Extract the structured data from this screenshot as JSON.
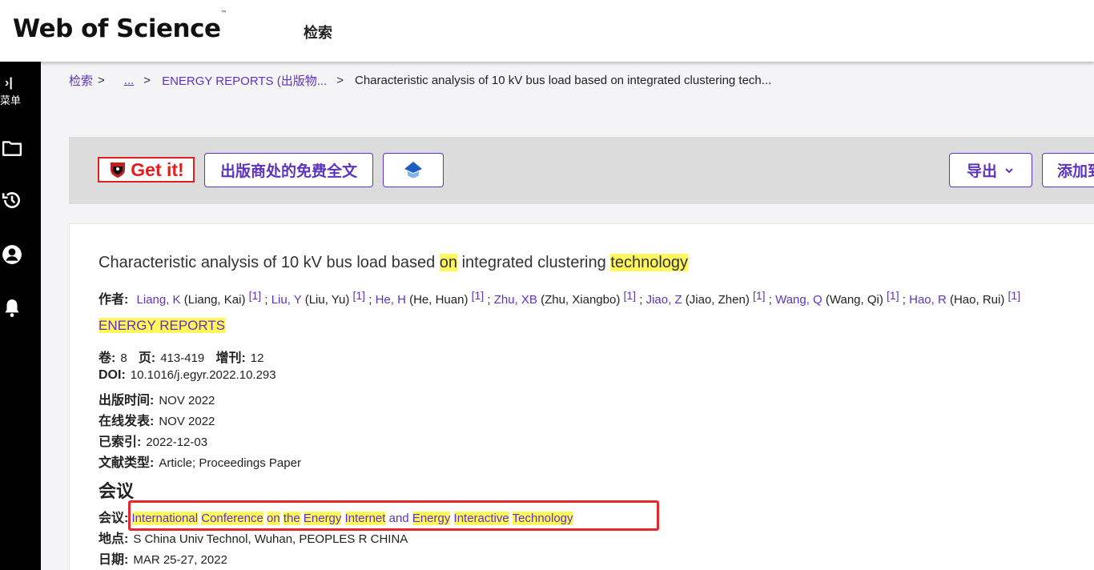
{
  "header": {
    "logo": "Web of Science",
    "logo_tm": "™",
    "nav_search": "检索"
  },
  "sidebar": {
    "expand_icon": "expand-icon",
    "menu_label": "菜单",
    "expand_glyph": "›|",
    "items": [
      {
        "icon": "folder-icon"
      },
      {
        "icon": "history-icon"
      },
      {
        "icon": "user-account-icon"
      },
      {
        "icon": "bell-icon"
      }
    ]
  },
  "breadcrumb": {
    "root": "检索",
    "ellipsis": "...",
    "journal": "ENERGY REPORTS (出版物...",
    "current": "Characteristic analysis of 10 kV bus load based on integrated clustering tech...",
    "sep": ">"
  },
  "actions": {
    "getit_label": "Get it!",
    "free_fulltext": "出版商处的免费全文",
    "gem_icon": "gem-icon",
    "export_label": "导出",
    "add_label": "添加到"
  },
  "record": {
    "title_parts": [
      "Characteristic analysis of 10 kV bus load based ",
      "on",
      " integrated clustering ",
      "technology"
    ],
    "authors_label": "作者:",
    "authors": [
      {
        "short": "Liang, K",
        "full": "(Liang, Kai)",
        "ref": "[1]"
      },
      {
        "short": "Liu, Y",
        "full": "(Liu, Yu)",
        "ref": "[1]"
      },
      {
        "short": "He, H",
        "full": "(He, Huan)",
        "ref": "[1]"
      },
      {
        "short": "Zhu, XB",
        "full": "(Zhu, Xiangbo)",
        "ref": "[1]"
      },
      {
        "short": "Jiao, Z",
        "full": "(Jiao, Zhen)",
        "ref": "[1]"
      },
      {
        "short": "Wang, Q",
        "full": "(Wang, Qi)",
        "ref": "[1]"
      },
      {
        "short": "Hao, R",
        "full": "(Hao, Rui)",
        "ref": "[1]"
      }
    ],
    "journal": "ENERGY REPORTS",
    "volume_label": "卷:",
    "volume": "8",
    "pages_label": "页:",
    "pages": "413-419",
    "supplement_label": "增刊:",
    "supplement": "12",
    "doi_label": "DOI:",
    "doi": "10.1016/j.egyr.2022.10.293",
    "pubdate_label": "出版时间:",
    "pubdate": "NOV 2022",
    "online_label": "在线发表:",
    "online": "NOV 2022",
    "indexed_label": "已索引:",
    "indexed": "2022-12-03",
    "doctype_label": "文献类型:",
    "doctype": "Article; Proceedings Paper",
    "conference_section": "会议",
    "conference_label": "会议:",
    "conference_words": [
      {
        "t": "International",
        "hl": true
      },
      {
        "t": "Conference",
        "hl": true
      },
      {
        "t": "on",
        "hl": true
      },
      {
        "t": "the",
        "hl": true
      },
      {
        "t": "Energy",
        "hl": true
      },
      {
        "t": "Internet",
        "hl": true
      },
      {
        "t": "and",
        "hl": false
      },
      {
        "t": "Energy",
        "hl": true
      },
      {
        "t": "Interactive",
        "hl": true
      },
      {
        "t": "Technology",
        "hl": true
      }
    ],
    "location_label": "地点:",
    "location": "S China Univ Technol, Wuhan, PEOPLES R CHINA",
    "date_label": "日期:",
    "date": "MAR 25-27, 2022"
  },
  "colors": {
    "accent": "#5e33bf",
    "highlight": "#fff85c",
    "annotation": "#e8262b"
  }
}
